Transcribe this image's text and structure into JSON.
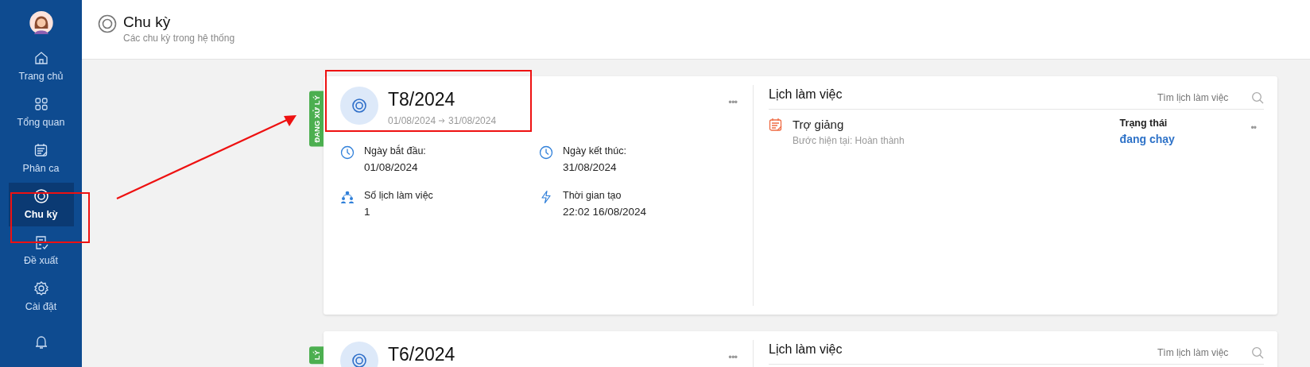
{
  "sidebar": {
    "items": [
      {
        "kind": "home",
        "label": "Trang chủ",
        "selected": false
      },
      {
        "kind": "grid",
        "label": "Tổng quan",
        "selected": false
      },
      {
        "kind": "calendar",
        "label": "Phân ca",
        "selected": false
      },
      {
        "kind": "target",
        "label": "Chu kỳ",
        "selected": true
      },
      {
        "kind": "document",
        "label": "Đề xuất",
        "selected": false
      },
      {
        "kind": "gear",
        "label": "Cài đặt",
        "selected": false
      },
      {
        "kind": "bell",
        "selected": false
      }
    ]
  },
  "header": {
    "title": "Chu kỳ",
    "subtitle": "Các chu kỳ trong hệ thống"
  },
  "cycles": [
    {
      "status": "ĐANG XỬ LÝ",
      "title": "T8/2024",
      "start": "01/08/2024",
      "end": "31/08/2024",
      "menu": "•••",
      "fields": [
        {
          "kind": "clock",
          "label": "Ngày bắt đầu:",
          "value": "01/08/2024"
        },
        {
          "kind": "clock",
          "label": "Ngày kết thúc:",
          "value": "31/08/2024"
        },
        {
          "kind": "people",
          "label": "Số lịch làm việc",
          "value": "1"
        },
        {
          "kind": "bolt",
          "label": "Thời gian tạo",
          "value": "22:02 16/08/2024"
        }
      ],
      "schedule": {
        "title": "Lịch làm việc",
        "search_placeholder": "Tìm lịch làm việc",
        "items": [
          {
            "name": "Trợ giảng",
            "step": "Bước hiện tại: Hoàn thành",
            "status_label": "Trạng thái",
            "status": "đang chạy",
            "menu": "••"
          }
        ]
      }
    },
    {
      "status": "LÝ",
      "title": "T6/2024",
      "menu": "•••",
      "schedule": {
        "title": "Lịch làm việc",
        "search_placeholder": "Tìm lịch làm việc"
      }
    }
  ]
}
